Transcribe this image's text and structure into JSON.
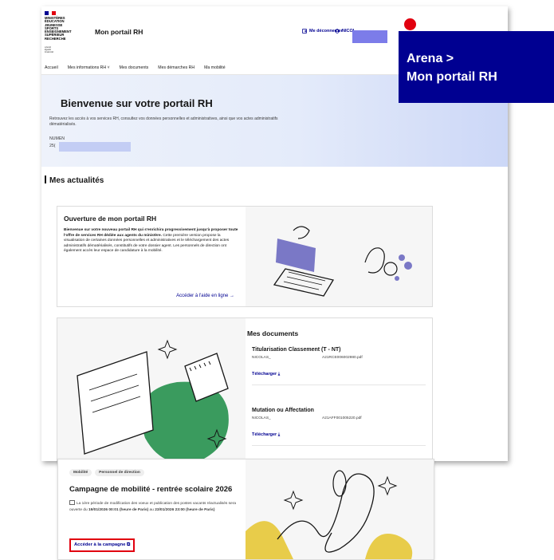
{
  "header": {
    "logo_lines": [
      "MINISTÈRES",
      "ÉDUCATION",
      "JEUNESSE",
      "SPORTS",
      "ENSEIGNEMENT",
      "SUPÉRIEUR",
      "RECHERCHE"
    ],
    "motto": [
      "Liberté",
      "Égalité",
      "Fraternité"
    ],
    "brand": "Mon portail RH",
    "logout": "Me déconnecter",
    "user": "NICOL"
  },
  "nav": {
    "items": [
      "Accueil",
      "Mes informations RH ˅",
      "Mes documents",
      "Mes démarches RH",
      "Ma mobilité"
    ]
  },
  "hero": {
    "title": "Bienvenue sur votre portail RH",
    "intro": "Retrouvez les accès à vos services RH, consultez vos données personnelles et administratives, ainsi que vos actes administratifs dématérialisés.",
    "numen_label": "NUMEN",
    "numen_value": "25("
  },
  "section": {
    "title": "Mes actualités"
  },
  "news": {
    "title": "Ouverture de mon portail RH",
    "body_bold": "Bienvenue sur votre nouveau portail RH qui s'enrichira progressivement jusqu'à proposer toute l'offre de services RH dédiée aux agents du ministère.",
    "body": " Cette première version propose la visualisation de certaines données personnelles et administratives et le téléchargement des actes administratifs dématérialisés, constitutifs de votre dossier agent. Les personnels de direction ont également accès leur espace de candidature à la mobilité.",
    "link": "Accéder à l'aide en ligne →"
  },
  "documents": {
    "title": "Mes documents",
    "items": [
      {
        "title": "Titularisation Classement (T - NT)",
        "owner": "NICOLAS_",
        "file": "A21RCE006002980.pdf",
        "download": "Télécharger ⤓"
      },
      {
        "title": "Mutation ou Affectation",
        "owner": "NICOLAS_",
        "file": "A21AFF001005220.pdf",
        "download": "Télécharger ⤓"
      }
    ]
  },
  "campaign": {
    "tags": [
      "Mobilité",
      "Personnel de direction"
    ],
    "title": "Campagne de mobilité - rentrée scolaire 2026",
    "desc_1": "La 1ère période de modification des voeux et publication des postes vacants réactualisés sera ouverte du ",
    "date_from": "19/01/2026 00:01 (heure de Paris)",
    "desc_2": " au ",
    "date_to": "23/01/2026 23:00 (heure de Paris)",
    "cta": "Accéder à la campagne ⧉"
  },
  "overlay": {
    "line1": "Arena >",
    "line2": "Mon portail RH"
  },
  "colors": {
    "primary": "#000091",
    "highlight": "#e1000f",
    "illustration_green": "#3a9b5e",
    "illustration_violet": "#7a78c6",
    "illustration_yellow": "#e8cc4a"
  }
}
